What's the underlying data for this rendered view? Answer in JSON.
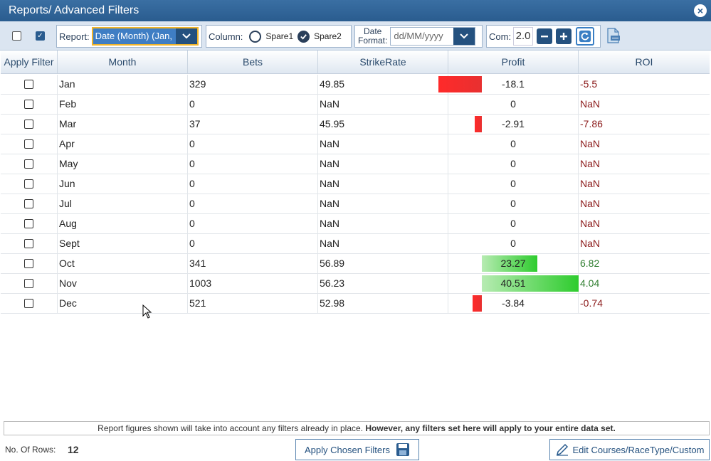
{
  "window": {
    "title": "Reports/ Advanced Filters",
    "close_label": "×"
  },
  "toolbar": {
    "report_label": "Report:",
    "report_value": "Date (Month) (Jan,",
    "column_label": "Column:",
    "spare1_label": "Spare1",
    "spare2_label": "Spare2",
    "date_label_1": "Date",
    "date_label_2": "Format:",
    "date_format_placeholder": "dd/MM/yyyy",
    "com_label": "Com:",
    "com_value": "2.0"
  },
  "columns": [
    "Apply Filter",
    "Month",
    "Bets",
    "StrikeRate",
    "Profit",
    "ROI"
  ],
  "rows": [
    {
      "month": "Jan",
      "bets": "329",
      "strike": "49.85",
      "profit": "-18.1",
      "profit_num": -18.1,
      "roi": "-5.5"
    },
    {
      "month": "Feb",
      "bets": "0",
      "strike": "NaN",
      "profit": "0",
      "profit_num": 0,
      "roi": "NaN"
    },
    {
      "month": "Mar",
      "bets": "37",
      "strike": "45.95",
      "profit": "-2.91",
      "profit_num": -2.91,
      "roi": "-7.86"
    },
    {
      "month": "Apr",
      "bets": "0",
      "strike": "NaN",
      "profit": "0",
      "profit_num": 0,
      "roi": "NaN"
    },
    {
      "month": "May",
      "bets": "0",
      "strike": "NaN",
      "profit": "0",
      "profit_num": 0,
      "roi": "NaN"
    },
    {
      "month": "Jun",
      "bets": "0",
      "strike": "NaN",
      "profit": "0",
      "profit_num": 0,
      "roi": "NaN"
    },
    {
      "month": "Jul",
      "bets": "0",
      "strike": "NaN",
      "profit": "0",
      "profit_num": 0,
      "roi": "NaN"
    },
    {
      "month": "Aug",
      "bets": "0",
      "strike": "NaN",
      "profit": "0",
      "profit_num": 0,
      "roi": "NaN"
    },
    {
      "month": "Sept",
      "bets": "0",
      "strike": "NaN",
      "profit": "0",
      "profit_num": 0,
      "roi": "NaN"
    },
    {
      "month": "Oct",
      "bets": "341",
      "strike": "56.89",
      "profit": "23.27",
      "profit_num": 23.27,
      "roi": "6.82"
    },
    {
      "month": "Nov",
      "bets": "1003",
      "strike": "56.23",
      "profit": "40.51",
      "profit_num": 40.51,
      "roi": "4.04"
    },
    {
      "month": "Dec",
      "bets": "521",
      "strike": "52.98",
      "profit": "-3.84",
      "profit_num": -3.84,
      "roi": "-0.74"
    }
  ],
  "note": {
    "text": "Report figures shown will take into account any filters already in place. ",
    "bold": "However, any filters set here will apply to your entire data set."
  },
  "footer": {
    "rows_label": "No. Of Rows:",
    "rows_count": "12",
    "apply_button": "Apply Chosen Filters",
    "edit_button": "Edit Courses/RaceType/Custom"
  },
  "colors": {
    "accent": "#2a5c8f",
    "negative": "#ff2a2a",
    "positive": "#2ecc2e"
  }
}
